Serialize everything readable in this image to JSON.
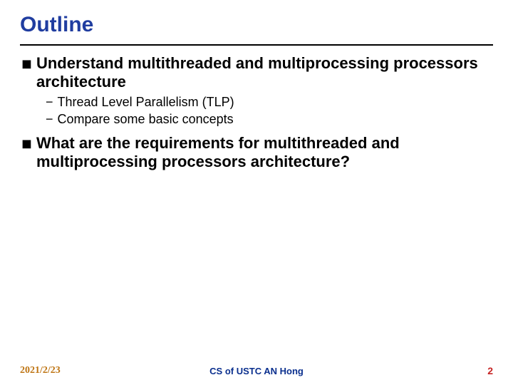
{
  "title": "Outline",
  "bullets": [
    {
      "text": "Understand multithreaded and multiprocessing processors architecture",
      "sub": [
        "Thread Level Parallelism (TLP)",
        "Compare some basic concepts"
      ]
    },
    {
      "text": "What are the requirements for multithreaded and multiprocessing processors architecture?",
      "sub": []
    }
  ],
  "footer": {
    "date": "2021/2/23",
    "center": "CS of USTC AN Hong",
    "page": "2"
  }
}
